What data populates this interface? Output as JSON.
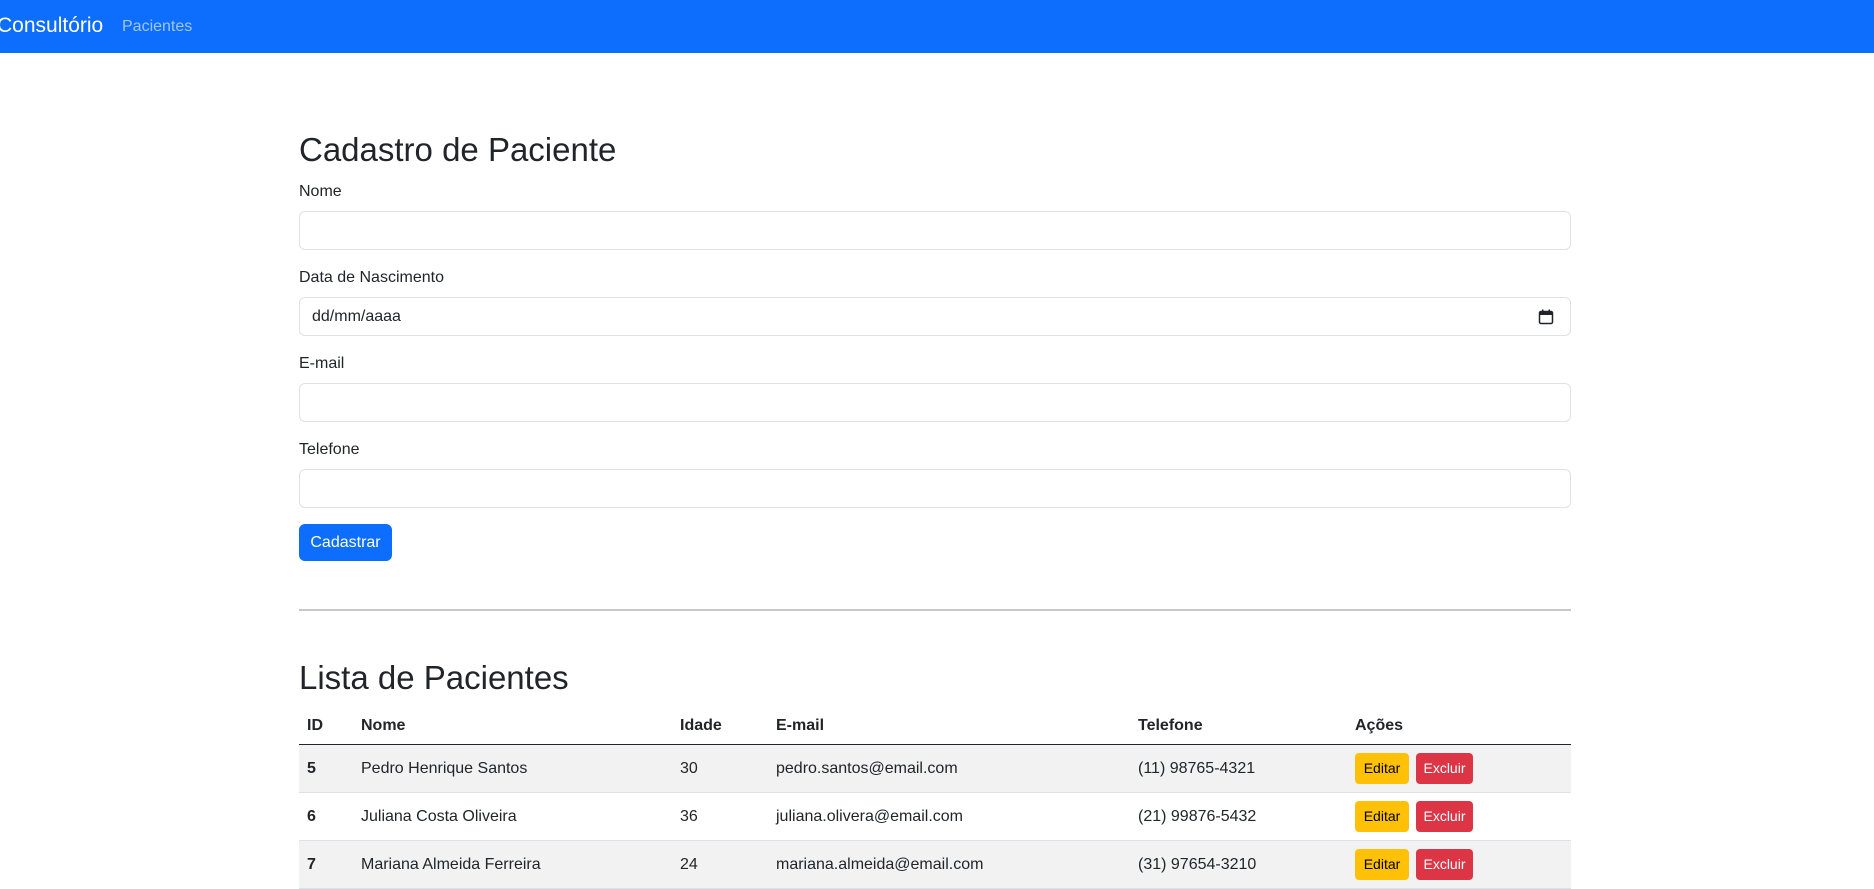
{
  "navbar": {
    "brand": "Consultório",
    "links": [
      "Pacientes"
    ]
  },
  "form": {
    "title": "Cadastro de Paciente",
    "fields": {
      "nome": {
        "label": "Nome",
        "value": ""
      },
      "nascimento": {
        "label": "Data de Nascimento",
        "value": "dd/mm/aaaa"
      },
      "email": {
        "label": "E-mail",
        "value": ""
      },
      "telefone": {
        "label": "Telefone",
        "value": ""
      }
    },
    "submit_label": "Cadastrar"
  },
  "list": {
    "title": "Lista de Pacientes",
    "columns": [
      "ID",
      "Nome",
      "Idade",
      "E-mail",
      "Telefone",
      "Ações"
    ],
    "rows": [
      {
        "id": "5",
        "nome": "Pedro Henrique Santos",
        "idade": "30",
        "email": "pedro.santos@email.com",
        "telefone": "(11) 98765-4321"
      },
      {
        "id": "6",
        "nome": "Juliana Costa Oliveira",
        "idade": "36",
        "email": "juliana.olivera@email.com",
        "telefone": "(21) 99876-5432"
      },
      {
        "id": "7",
        "nome": "Mariana Almeida Ferreira",
        "idade": "24",
        "email": "mariana.almeida@email.com",
        "telefone": "(31) 97654-3210"
      }
    ],
    "edit_label": "Editar",
    "delete_label": "Excluir"
  },
  "colors": {
    "primary": "#0d6efd",
    "warning": "#ffc107",
    "danger": "#dc3545"
  }
}
